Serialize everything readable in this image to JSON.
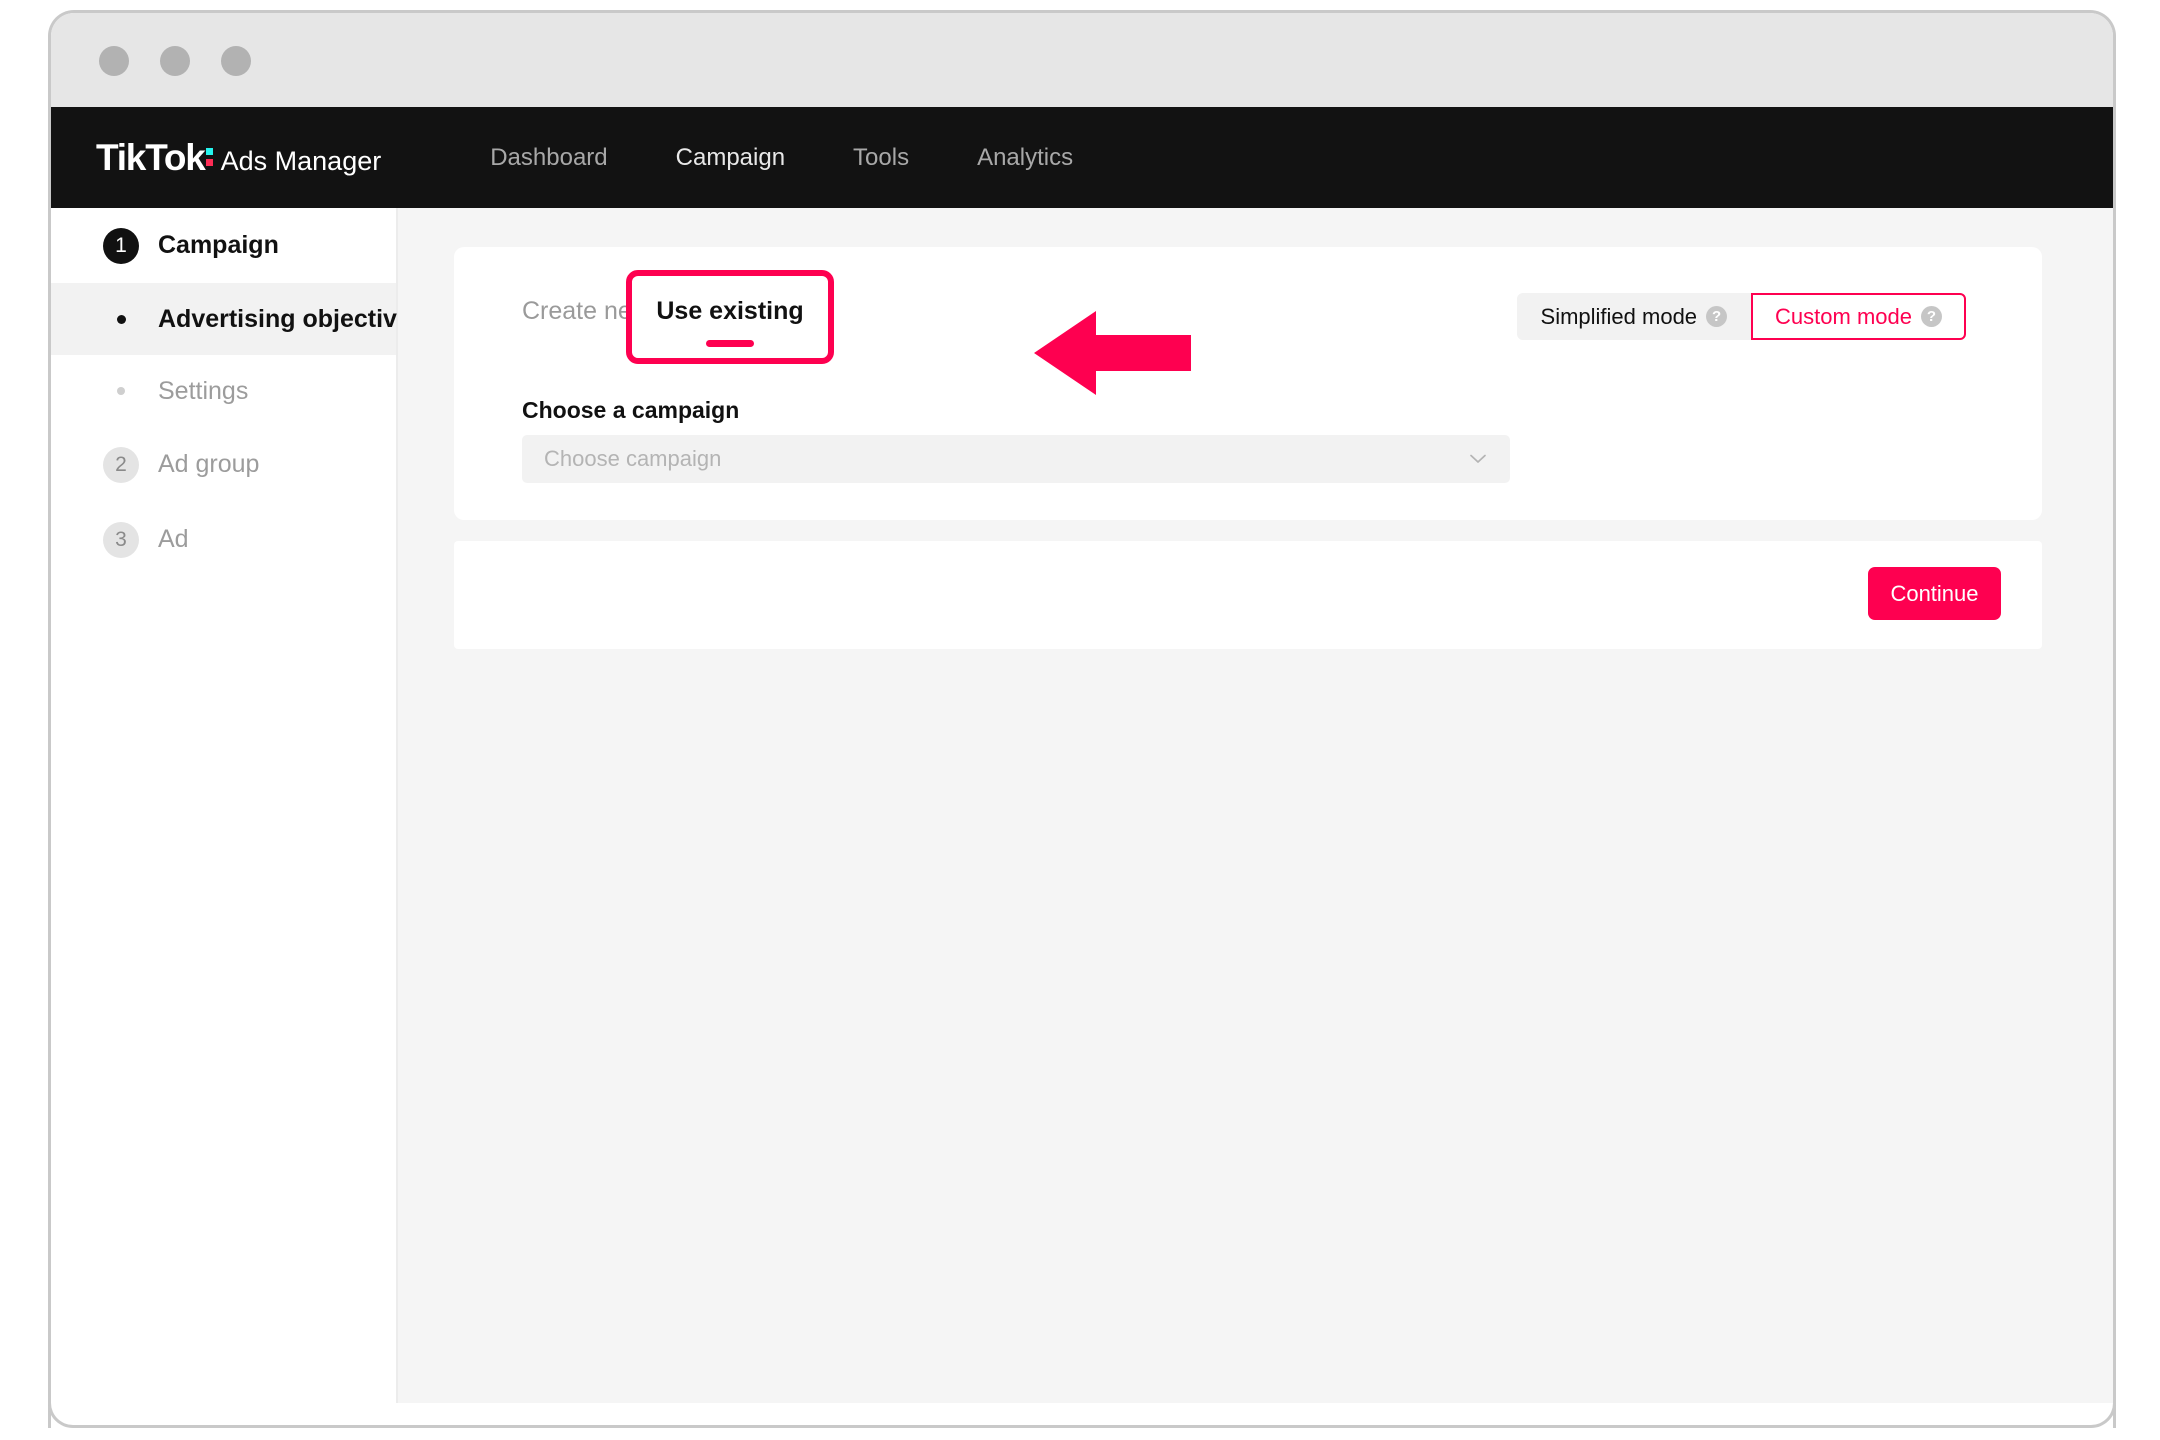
{
  "window": {
    "traffic_lights": [
      "close",
      "minimize",
      "maximize"
    ]
  },
  "navbar": {
    "brand_logo": "TikTok",
    "brand_suffix": "Ads Manager",
    "brand_accent_cyan": "#25f4ee",
    "brand_accent_pink": "#fe2c55",
    "links": [
      {
        "label": "Dashboard",
        "active": false
      },
      {
        "label": "Campaign",
        "active": true
      },
      {
        "label": "Tools",
        "active": false
      },
      {
        "label": "Analytics",
        "active": false
      }
    ]
  },
  "sidebar": {
    "steps": [
      {
        "badge": "1",
        "label": "Campaign",
        "state": "active"
      },
      {
        "badge": "2",
        "label": "Ad group",
        "state": "muted"
      },
      {
        "badge": "3",
        "label": "Ad",
        "state": "muted"
      }
    ],
    "sub_items": [
      {
        "label": "Advertising objective",
        "state": "selected"
      },
      {
        "label": "Settings",
        "state": "muted"
      }
    ]
  },
  "main": {
    "tabs": [
      {
        "label": "Create new",
        "active": false
      },
      {
        "label": "Use existing",
        "active": true
      }
    ],
    "mode_toggle": {
      "options": [
        {
          "label": "Simplified mode",
          "selected": false,
          "help": "?"
        },
        {
          "label": "Custom mode",
          "selected": true,
          "help": "?"
        }
      ]
    },
    "field": {
      "label": "Choose a campaign",
      "placeholder": "Choose campaign",
      "value": "",
      "chevron": "chevron-down-icon"
    },
    "footer": {
      "continue_label": "Continue"
    }
  },
  "annotation": {
    "arrow": "left-pointing-arrow",
    "arrow_color": "#fe0050",
    "highlight_color": "#fe0050"
  },
  "colors": {
    "accent_pink": "#fe0050",
    "navbar_bg": "#121212",
    "titlebar_bg": "#e6e6e6",
    "content_bg": "#f5f5f5",
    "card_bg": "#ffffff"
  }
}
